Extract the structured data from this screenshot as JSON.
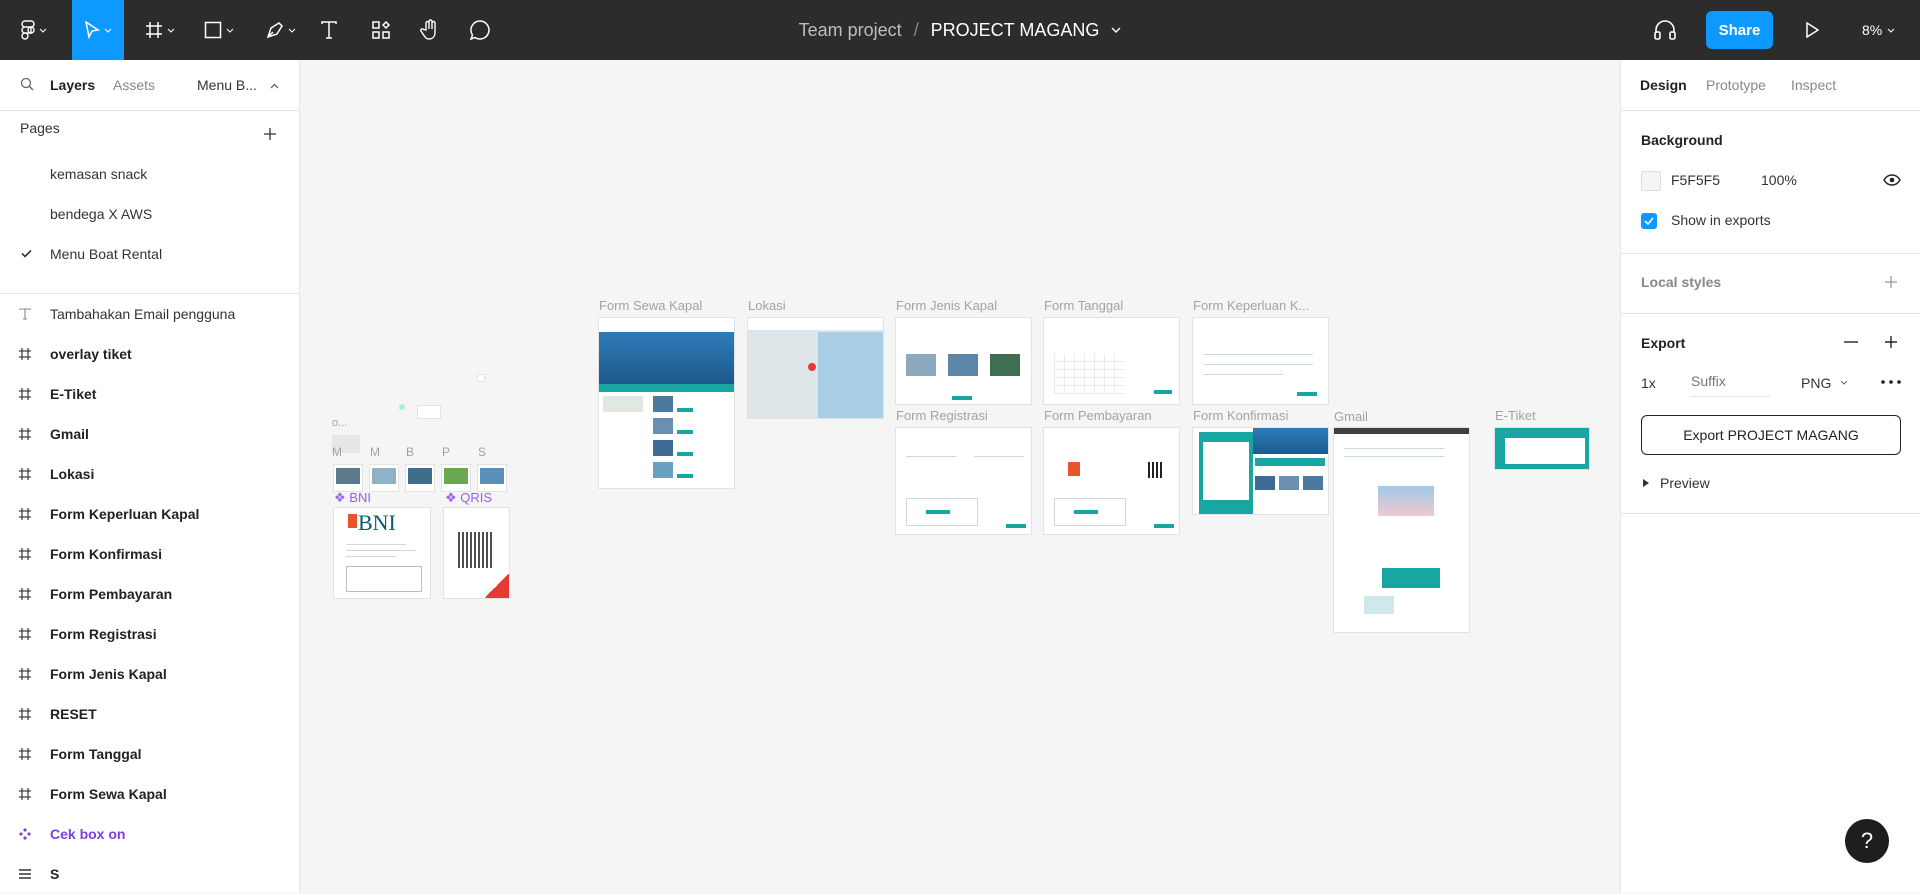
{
  "toolbar": {
    "project_team": "Team project",
    "separator": "/",
    "project_name": "PROJECT MAGANG",
    "share_label": "Share",
    "zoom": "8%",
    "tools": [
      "figma-menu-icon",
      "move-icon",
      "frame-icon",
      "shape-icon",
      "pen-icon",
      "text-icon",
      "resources-icon",
      "hand-icon",
      "comment-icon"
    ]
  },
  "left_panel": {
    "tabs": [
      "Layers",
      "Assets",
      "Menu B..."
    ],
    "pages_title": "Pages",
    "pages": [
      "kemasan snack",
      "bendega X AWS",
      "Menu Boat Rental"
    ],
    "current_page": "Menu Boat Rental",
    "layers": [
      {
        "name": "Tambahakan Email pengguna",
        "type": "text"
      },
      {
        "name": "overlay tiket",
        "type": "frame"
      },
      {
        "name": "E-Tiket",
        "type": "frame"
      },
      {
        "name": "Gmail",
        "type": "frame"
      },
      {
        "name": "Lokasi",
        "type": "frame"
      },
      {
        "name": "Form Keperluan Kapal",
        "type": "frame"
      },
      {
        "name": "Form Konfirmasi",
        "type": "frame"
      },
      {
        "name": "Form Pembayaran",
        "type": "frame"
      },
      {
        "name": "Form Registrasi",
        "type": "frame"
      },
      {
        "name": "Form Jenis Kapal",
        "type": "frame"
      },
      {
        "name": "RESET",
        "type": "frame"
      },
      {
        "name": "Form Tanggal",
        "type": "frame"
      },
      {
        "name": "Form Sewa Kapal",
        "type": "frame"
      },
      {
        "name": "Cek box on",
        "type": "component"
      },
      {
        "name": "S",
        "type": "group"
      }
    ]
  },
  "canvas": {
    "frames": {
      "sewa": "Form Sewa Kapal",
      "lokasi": "Lokasi",
      "jenis": "Form Jenis Kapal",
      "tanggal": "Form Tanggal",
      "keperluan": "Form Keperluan K...",
      "registrasi": "Form Registrasi",
      "pembayaran": "Form Pembayaran",
      "konfirmasi": "Form Konfirmasi",
      "gmail": "Gmail",
      "etiket": "E-Tiket"
    },
    "small_labels": {
      "o": "o...",
      "m1": "M",
      "m2": "M",
      "b": "B",
      "p": "P",
      "s": "S"
    },
    "bni": "BNI",
    "qris": "QRIS",
    "bni_logo": "BNI"
  },
  "right_panel": {
    "tabs": [
      "Design",
      "Prototype",
      "Inspect"
    ],
    "background_title": "Background",
    "bg_hex": "F5F5F5",
    "bg_opacity": "100%",
    "show_in_exports": "Show in exports",
    "local_styles": "Local styles",
    "export_title": "Export",
    "export_scale": "1x",
    "export_suffix_placeholder": "Suffix",
    "export_format": "PNG",
    "export_button": "Export PROJECT MAGANG",
    "preview": "Preview"
  },
  "help": "?",
  "colors": {
    "toolbar": "#2c2c2c",
    "accent": "#0d99ff",
    "teal": "#17a6a1",
    "component": "#7b3fe4",
    "canvas": "#f5f5f5"
  }
}
